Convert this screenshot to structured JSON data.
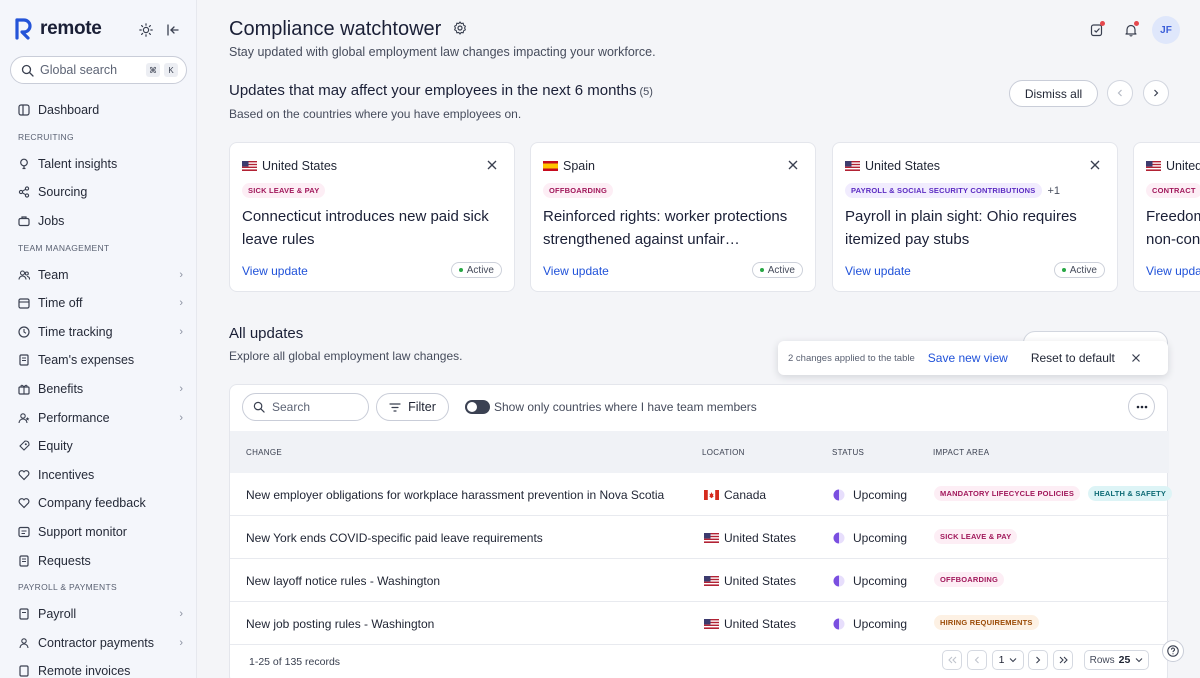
{
  "brand": {
    "name": "remote"
  },
  "sidebar": {
    "search_placeholder": "Global search",
    "search_kbd_1": "⌘",
    "search_kbd_2": "K",
    "dashboard": "Dashboard",
    "sections": {
      "recruiting": "RECRUITING",
      "team_management": "TEAM MANAGEMENT",
      "payroll": "PAYROLL & PAYMENTS"
    },
    "items": {
      "talent_insights": "Talent insights",
      "sourcing": "Sourcing",
      "jobs": "Jobs",
      "team": "Team",
      "time_off": "Time off",
      "time_tracking": "Time tracking",
      "team_expenses": "Team's expenses",
      "benefits": "Benefits",
      "performance": "Performance",
      "equity": "Equity",
      "incentives": "Incentives",
      "company_feedback": "Company feedback",
      "support_monitor": "Support monitor",
      "requests": "Requests",
      "payroll": "Payroll",
      "contractor_payments": "Contractor payments",
      "remote_invoices": "Remote invoices"
    }
  },
  "header": {
    "title": "Compliance watchtower",
    "subtitle": "Stay updated with global employment law changes impacting your workforce.",
    "avatar_initials": "JF"
  },
  "updates": {
    "title": "Updates that may affect your employees in the next 6 months",
    "count": "(5)",
    "subtitle": "Based on the countries where you have employees on.",
    "dismiss_label": "Dismiss all",
    "cards": [
      {
        "country": "United States",
        "tag": "SICK LEAVE & PAY",
        "extra": "",
        "title": "Connecticut introduces new paid sick leave rules",
        "link": "View update",
        "status": "Active"
      },
      {
        "country": "Spain",
        "tag": "OFFBOARDING",
        "extra": "",
        "title": "Reinforced rights: worker protections strengthened against unfair…",
        "link": "View update",
        "status": "Active"
      },
      {
        "country": "United States",
        "tag": "PAYROLL & SOCIAL SECURITY CONTRIBUTIONS",
        "extra": "+1",
        "title": "Payroll in plain sight: Ohio requires itemized pay stubs",
        "link": "View update",
        "status": "Active"
      },
      {
        "country": "United",
        "tag": "CONTRACT",
        "extra": "",
        "title": "Freedom non-con",
        "link": "View upda",
        "status": ""
      }
    ]
  },
  "all_updates": {
    "title": "All updates",
    "subtitle": "Explore all global employment law changes.",
    "toast": {
      "message": "2 changes applied to the table",
      "save": "Save new view",
      "reset": "Reset to default"
    },
    "search_placeholder": "Search",
    "filter_label": "Filter",
    "toggle_label": "Show only countries where I have team members",
    "columns": {
      "change": "CHANGE",
      "location": "LOCATION",
      "status": "STATUS",
      "impact": "IMPACT AREA"
    },
    "rows": [
      {
        "change": "New employer obligations for workplace harassment prevention in Nova Scotia",
        "location": "Canada",
        "status": "Upcoming",
        "tags": [
          "MANDATORY LIFECYCLE POLICIES",
          "HEALTH & SAFETY"
        ]
      },
      {
        "change": "New York ends COVID-specific paid leave requirements",
        "location": "United States",
        "status": "Upcoming",
        "tags": [
          "SICK LEAVE & PAY"
        ]
      },
      {
        "change": "New layoff notice rules - Washington",
        "location": "United States",
        "status": "Upcoming",
        "tags": [
          "OFFBOARDING"
        ]
      },
      {
        "change": "New job posting rules - Washington",
        "location": "United States",
        "status": "Upcoming",
        "tags": [
          "HIRING REQUIREMENTS"
        ]
      }
    ],
    "footer": {
      "records": "1-25 of 135 records",
      "page": "1",
      "rows_label": "Rows",
      "rows_value": "25"
    }
  }
}
